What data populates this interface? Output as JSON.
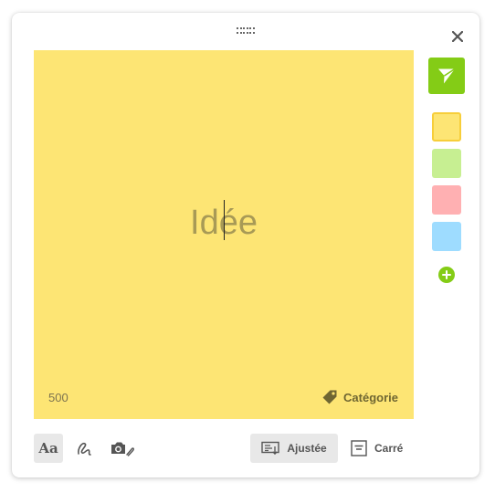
{
  "note": {
    "text": "Idée",
    "char_counter": "500",
    "category_label": "Catégorie",
    "background": "#fde574"
  },
  "colors": {
    "accent": "#84cc16",
    "swatches": [
      "#fde574",
      "#c7ef92",
      "#ffb0b2",
      "#9edcff"
    ],
    "selected_swatch": "yellow"
  },
  "toolbar": {
    "text_tool_label": "Aa",
    "fit_label": "Ajustée",
    "square_label": "Carré"
  },
  "icons": [
    "drag-handle-icon",
    "close-icon",
    "send-icon",
    "plus-icon",
    "tag-icon",
    "draw-icon",
    "camera-icon",
    "fit-layout-icon",
    "square-layout-icon"
  ]
}
